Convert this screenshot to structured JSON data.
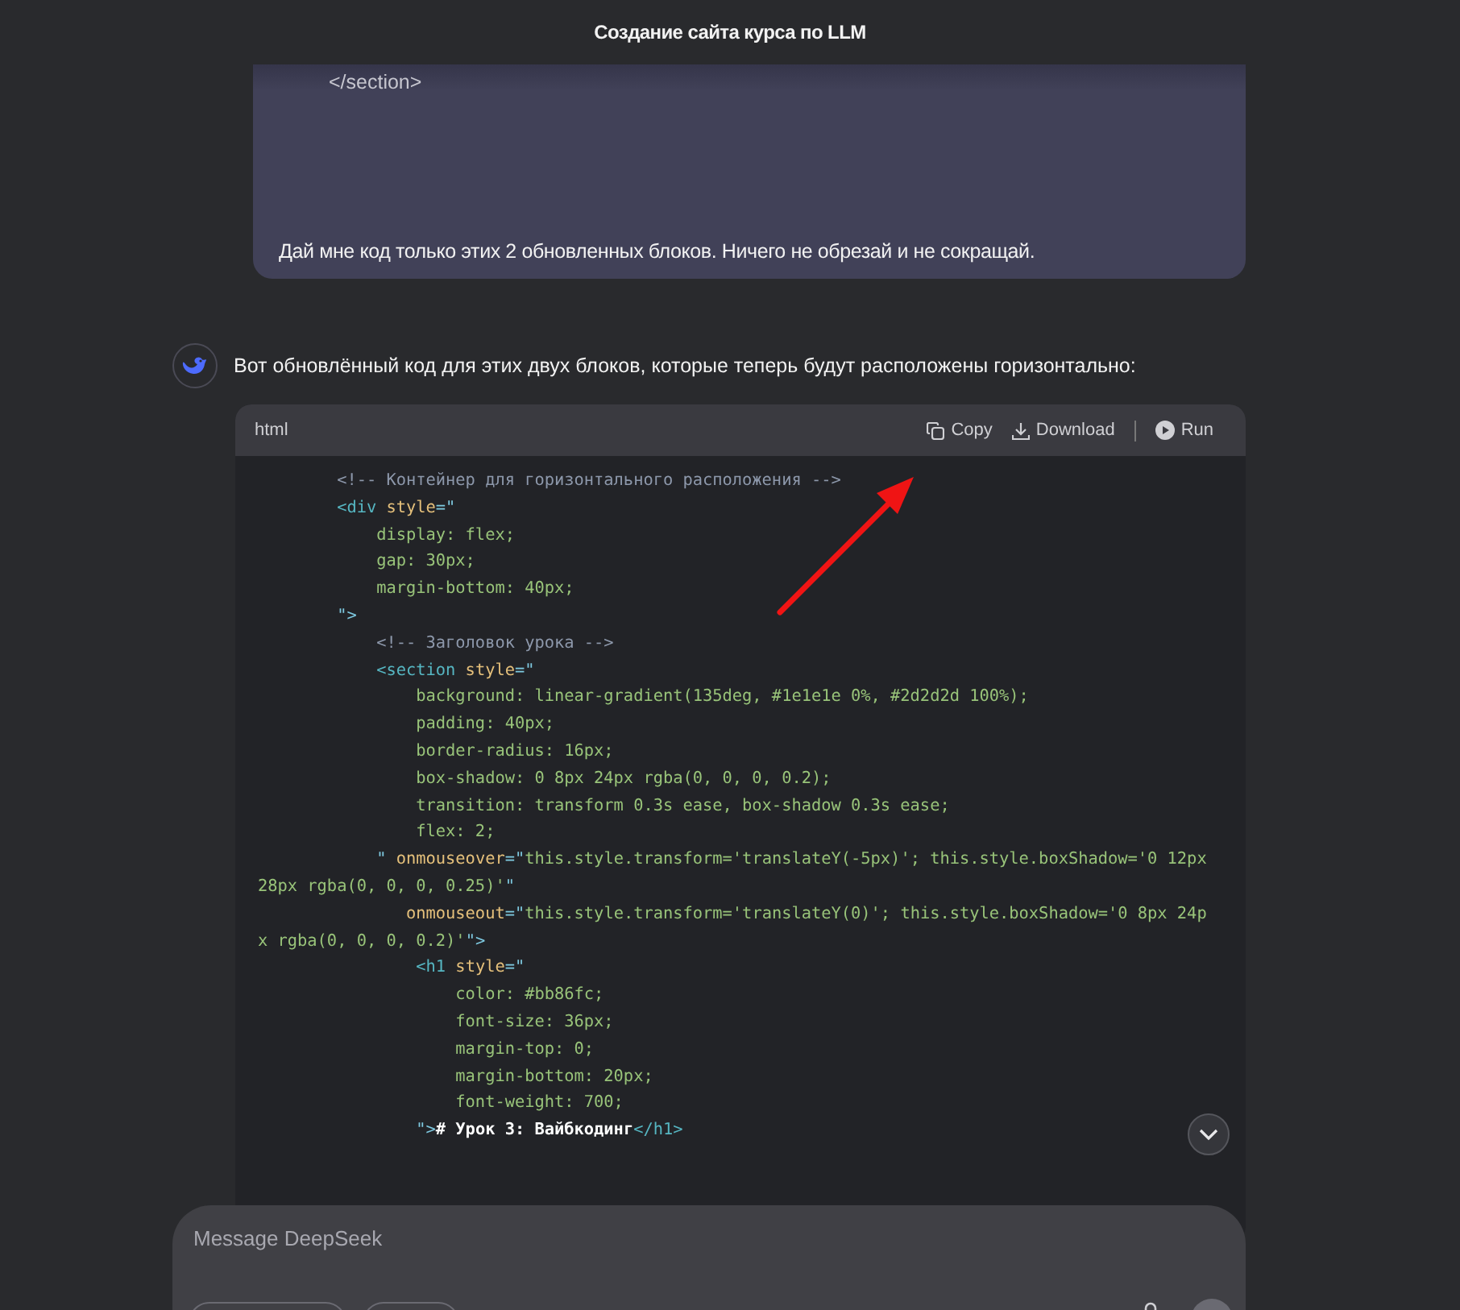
{
  "window": {
    "title": "Создание сайта курса по LLM"
  },
  "user_message": {
    "quoted_code": "</section>",
    "text": "Дай мне код только этих 2 обновленных блоков. Ничего не обрезай и не сокращай."
  },
  "assistant_message": {
    "text": "Вот обновлённый код для этих двух блоков, которые теперь будут расположены горизонтально:",
    "code_block": {
      "language": "html",
      "actions": [
        {
          "kind": "copy",
          "label": "Copy"
        },
        {
          "kind": "download",
          "label": "Download"
        },
        {
          "kind": "run",
          "label": "Run"
        }
      ],
      "lines": [
        [
          {
            "kind": "comment",
            "text": "        <!-- Контейнер для горизонтального расположения -->"
          }
        ],
        [
          {
            "kind": "tag",
            "text": "        <div"
          },
          {
            "kind": "attr",
            "text": " style"
          },
          {
            "kind": "punct",
            "text": "=\""
          }
        ],
        [
          {
            "kind": "value",
            "text": "            display: flex;"
          }
        ],
        [
          {
            "kind": "value",
            "text": "            gap: 30px;"
          }
        ],
        [
          {
            "kind": "value",
            "text": "            margin-bottom: 40px;"
          }
        ],
        [
          {
            "kind": "punct",
            "text": "        \">"
          }
        ],
        [
          {
            "kind": "comment",
            "text": "            <!-- Заголовок урока -->"
          }
        ],
        [
          {
            "kind": "tag",
            "text": "            <section"
          },
          {
            "kind": "attr",
            "text": " style"
          },
          {
            "kind": "punct",
            "text": "=\""
          }
        ],
        [
          {
            "kind": "value",
            "text": "                background: linear-gradient(135deg, #1e1e1e 0%, #2d2d2d 100%);"
          }
        ],
        [
          {
            "kind": "value",
            "text": "                padding: 40px;"
          }
        ],
        [
          {
            "kind": "value",
            "text": "                border-radius: 16px;"
          }
        ],
        [
          {
            "kind": "value",
            "text": "                box-shadow: 0 8px 24px rgba(0, 0, 0, 0.2);"
          }
        ],
        [
          {
            "kind": "value",
            "text": "                transition: transform 0.3s ease, box-shadow 0.3s ease;"
          }
        ],
        [
          {
            "kind": "value",
            "text": "                flex: 2;"
          }
        ],
        [
          {
            "kind": "punct",
            "text": "            \" "
          },
          {
            "kind": "attr",
            "text": "onmouseover"
          },
          {
            "kind": "punct",
            "text": "=\""
          },
          {
            "kind": "value",
            "text": "this.style.transform='translateY(-5px)'; this.style.boxShadow='0 12px"
          }
        ],
        [
          {
            "kind": "value",
            "text": "28px rgba(0, 0, 0, 0.25)'"
          },
          {
            "kind": "punct",
            "text": "\""
          }
        ],
        [
          {
            "kind": "attr",
            "text": "               onmouseout"
          },
          {
            "kind": "punct",
            "text": "=\""
          },
          {
            "kind": "value",
            "text": "this.style.transform='translateY(0)'; this.style.boxShadow='0 8px 24p"
          }
        ],
        [
          {
            "kind": "value",
            "text": "x rgba(0, 0, 0, 0.2)'"
          },
          {
            "kind": "punct",
            "text": "\">"
          }
        ],
        [
          {
            "kind": "tag",
            "text": "                <h1"
          },
          {
            "kind": "attr",
            "text": " style"
          },
          {
            "kind": "punct",
            "text": "=\""
          }
        ],
        [
          {
            "kind": "value",
            "text": "                    color: #bb86fc;"
          }
        ],
        [
          {
            "kind": "value",
            "text": "                    font-size: 36px;"
          }
        ],
        [
          {
            "kind": "value",
            "text": "                    margin-top: 0;"
          }
        ],
        [
          {
            "kind": "value",
            "text": "                    margin-bottom: 20px;"
          }
        ],
        [
          {
            "kind": "value",
            "text": "                    font-weight: 700;"
          }
        ],
        [
          {
            "kind": "punct",
            "text": "                \">"
          },
          {
            "kind": "text",
            "text": "# Урок 3: Вайбкодинг"
          },
          {
            "kind": "tag",
            "text": "</h1>"
          }
        ]
      ]
    }
  },
  "composer": {
    "placeholder": "Message DeepSeek"
  }
}
